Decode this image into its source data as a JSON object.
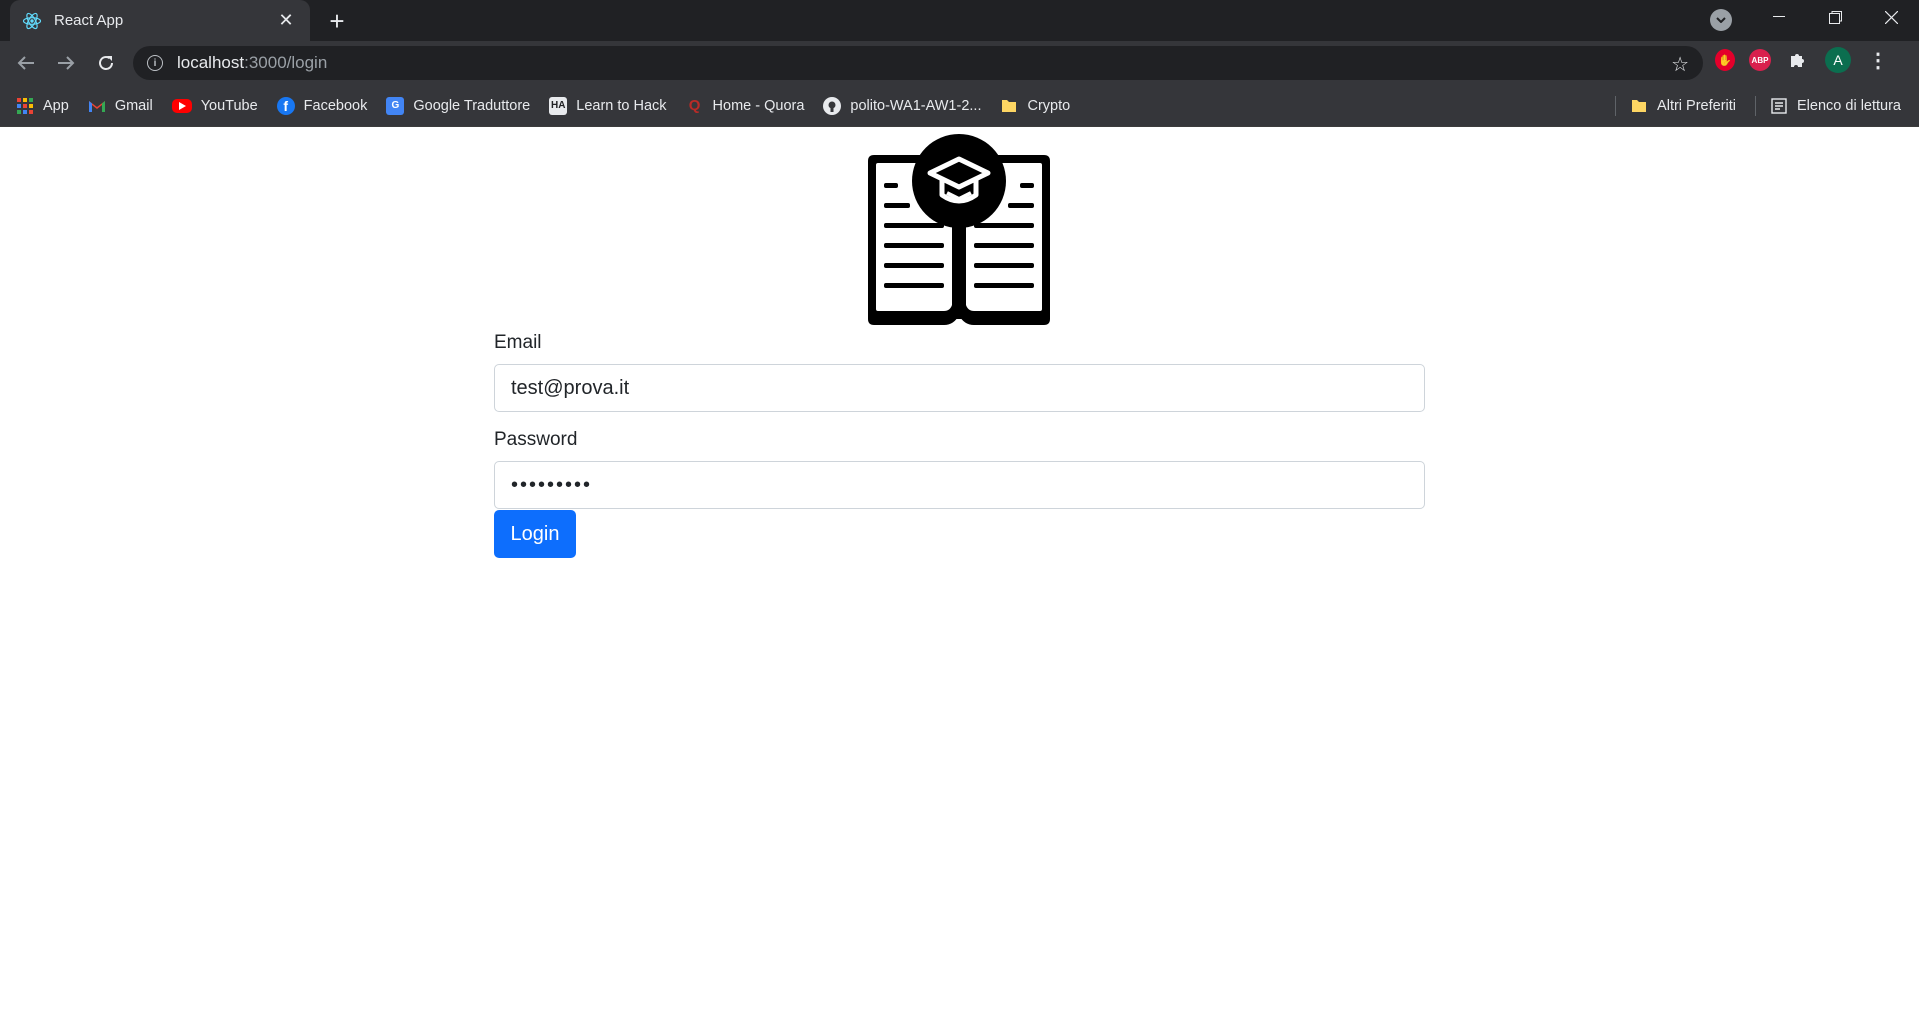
{
  "browser": {
    "tab_title": "React App",
    "tab_icon": "react-icon",
    "new_tab_symbol": "+",
    "url_host": "localhost",
    "url_path": ":3000/login",
    "profile_initial": "A",
    "abp_label": "ABP"
  },
  "bookmarks": {
    "items": [
      {
        "label": "App",
        "icon": "apps-grid-icon"
      },
      {
        "label": "Gmail",
        "icon": "gmail-icon"
      },
      {
        "label": "YouTube",
        "icon": "youtube-icon"
      },
      {
        "label": "Facebook",
        "icon": "facebook-icon"
      },
      {
        "label": "Google Traduttore",
        "icon": "google-translate-icon"
      },
      {
        "label": "Learn to Hack",
        "icon": "hackaday-icon"
      },
      {
        "label": "Home - Quora",
        "icon": "quora-icon"
      },
      {
        "label": "polito-WA1-AW1-2...",
        "icon": "github-icon"
      },
      {
        "label": "Crypto",
        "icon": "folder-icon"
      }
    ],
    "other_favorites": "Altri Preferiti",
    "reading_list": "Elenco di lettura"
  },
  "login": {
    "logo_icon": "book-graduation-cap-icon",
    "email_label": "Email",
    "email_value": "test@prova.it",
    "password_label": "Password",
    "password_value": "•••••••••",
    "submit_label": "Login"
  },
  "colors": {
    "primary": "#0d6efd",
    "chrome_dark": "#202124",
    "chrome_toolbar": "#35363a"
  }
}
